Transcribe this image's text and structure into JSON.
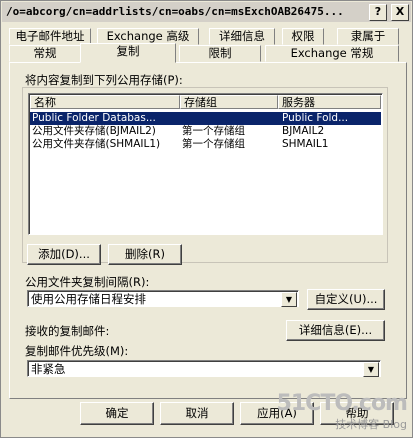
{
  "window": {
    "title": "/o=abcorg/cn=addrlists/cn=oabs/cn=msExchOAB26475...",
    "help_label": "?",
    "close_label": "X"
  },
  "tabs": {
    "row1": [
      "电子邮件地址",
      "Exchange 高级",
      "详细信息",
      "权限",
      "隶属于"
    ],
    "row2": [
      "常规",
      "复制",
      "限制",
      "Exchange 常规"
    ],
    "active": "复制"
  },
  "replication": {
    "list_label": "将内容复制到下列公用存储(P):",
    "columns": [
      "名称",
      "存储组",
      "服务器"
    ],
    "rows": [
      {
        "name": "Public Folder Databas...",
        "group": "",
        "server": "Public Fold...",
        "selected": true
      },
      {
        "name": "公用文件夹存储(BJMAIL2)",
        "group": "第一个存储组",
        "server": "BJMAIL2",
        "selected": false
      },
      {
        "name": "公用文件夹存储(SHMAIL1)",
        "group": "第一个存储组",
        "server": "SHMAIL1",
        "selected": false
      }
    ],
    "add_button": "添加(D)...",
    "remove_button": "删除(R)"
  },
  "interval": {
    "label": "公用文件夹复制间隔(R):",
    "value": "使用公用存储日程安排",
    "customize_button": "自定义(U)..."
  },
  "messages": {
    "label": "接收的复制邮件:",
    "details_button": "详细信息(E)..."
  },
  "priority": {
    "label": "复制邮件优先级(M):",
    "value": "非紧急"
  },
  "footer": {
    "ok": "确定",
    "cancel": "取消",
    "apply": "应用(A)",
    "help": "帮助"
  },
  "watermark": {
    "site": "51CTO.com",
    "blog": "技术博客 Blog"
  }
}
